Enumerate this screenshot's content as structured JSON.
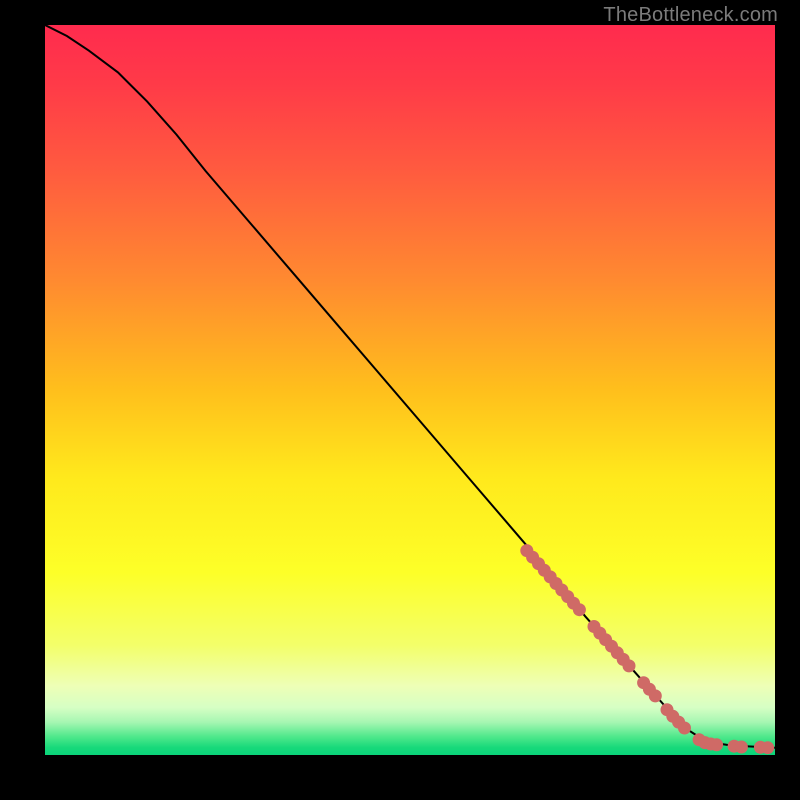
{
  "attribution": "TheBottleneck.com",
  "gradient": {
    "stops": [
      {
        "offset": 0.0,
        "color": "#ff2b4e"
      },
      {
        "offset": 0.08,
        "color": "#ff3a48"
      },
      {
        "offset": 0.2,
        "color": "#ff5b3f"
      },
      {
        "offset": 0.35,
        "color": "#ff8a30"
      },
      {
        "offset": 0.5,
        "color": "#ffbf1c"
      },
      {
        "offset": 0.62,
        "color": "#ffe91c"
      },
      {
        "offset": 0.75,
        "color": "#fdff28"
      },
      {
        "offset": 0.85,
        "color": "#f3ff6a"
      },
      {
        "offset": 0.905,
        "color": "#eeffb6"
      },
      {
        "offset": 0.935,
        "color": "#d6ffc4"
      },
      {
        "offset": 0.955,
        "color": "#a6f6b2"
      },
      {
        "offset": 0.975,
        "color": "#4fe88b"
      },
      {
        "offset": 0.99,
        "color": "#17d97a"
      },
      {
        "offset": 1.0,
        "color": "#0ad47a"
      }
    ]
  },
  "point_color": "#cf6a66",
  "line_color": "#000000",
  "chart_data": {
    "type": "line",
    "title": "",
    "xlabel": "",
    "ylabel": "",
    "xlim": [
      0,
      100
    ],
    "ylim": [
      0,
      100
    ],
    "grid": false,
    "series": [
      {
        "name": "curve",
        "x": [
          0,
          3,
          6,
          10,
          14,
          18,
          22,
          28,
          34,
          40,
          46,
          52,
          58,
          64,
          70,
          74,
          78,
          82,
          86,
          88,
          90,
          92,
          94,
          96,
          98,
          100
        ],
        "y": [
          100,
          98.5,
          96.5,
          93.5,
          89.5,
          85,
          80,
          73,
          66,
          59,
          52,
          45,
          38,
          31,
          24,
          19,
          14.5,
          10,
          5.5,
          3.5,
          2.2,
          1.6,
          1.3,
          1.2,
          1.1,
          1.0
        ]
      }
    ],
    "markers": [
      {
        "x": 66.0,
        "y": 28.0
      },
      {
        "x": 66.8,
        "y": 27.1
      },
      {
        "x": 67.6,
        "y": 26.2
      },
      {
        "x": 68.4,
        "y": 25.3
      },
      {
        "x": 69.2,
        "y": 24.4
      },
      {
        "x": 70.0,
        "y": 23.5
      },
      {
        "x": 70.8,
        "y": 22.6
      },
      {
        "x": 71.6,
        "y": 21.7
      },
      {
        "x": 72.4,
        "y": 20.8
      },
      {
        "x": 73.2,
        "y": 19.9
      },
      {
        "x": 75.2,
        "y": 17.6
      },
      {
        "x": 76.0,
        "y": 16.7
      },
      {
        "x": 76.8,
        "y": 15.8
      },
      {
        "x": 77.6,
        "y": 14.9
      },
      {
        "x": 78.4,
        "y": 14.0
      },
      {
        "x": 79.2,
        "y": 13.1
      },
      {
        "x": 80.0,
        "y": 12.2
      },
      {
        "x": 82.0,
        "y": 9.9
      },
      {
        "x": 82.8,
        "y": 9.0
      },
      {
        "x": 83.6,
        "y": 8.1
      },
      {
        "x": 85.2,
        "y": 6.2
      },
      {
        "x": 86.0,
        "y": 5.3
      },
      {
        "x": 86.8,
        "y": 4.5
      },
      {
        "x": 87.6,
        "y": 3.7
      },
      {
        "x": 89.6,
        "y": 2.1
      },
      {
        "x": 90.4,
        "y": 1.7
      },
      {
        "x": 91.2,
        "y": 1.5
      },
      {
        "x": 92.0,
        "y": 1.4
      },
      {
        "x": 94.4,
        "y": 1.2
      },
      {
        "x": 95.4,
        "y": 1.1
      },
      {
        "x": 98.0,
        "y": 1.05
      },
      {
        "x": 99.0,
        "y": 1.0
      }
    ]
  }
}
